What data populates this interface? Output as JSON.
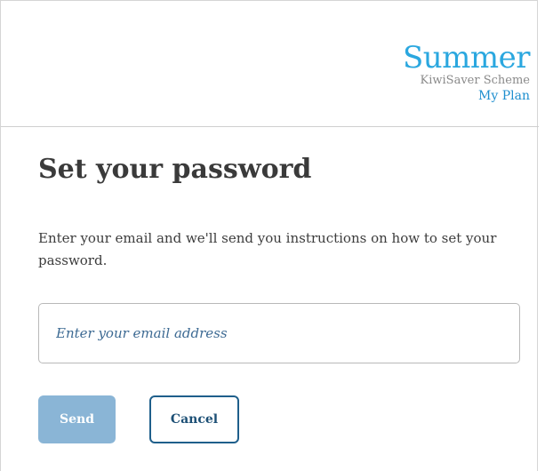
{
  "brand": {
    "name": "Summer",
    "subtitle": "KiwiSaver Scheme",
    "plan": "My Plan"
  },
  "page": {
    "title": "Set your password",
    "description": "Enter your email and we'll send you instructions on how to set your password."
  },
  "form": {
    "email_placeholder": "Enter your email address",
    "email_value": "",
    "send_label": "Send",
    "cancel_label": "Cancel"
  },
  "colors": {
    "brand_blue": "#2aa7df",
    "send_button": "#8ab5d6",
    "cancel_border": "#1f5f8b"
  }
}
